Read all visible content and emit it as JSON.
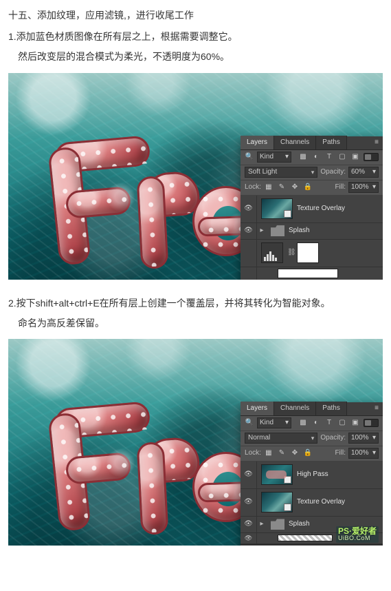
{
  "watermark": {
    "brand": "PS·爱好者",
    "url": "UiBO.CoM"
  },
  "sectionTitle": "十五、添加纹理，应用滤镜,，进行收尾工作",
  "step1": {
    "line1": "1.添加蓝色材质图像在所有层之上，根据需要调整它。",
    "line2": "然后改变层的混合模式为柔光，不透明度为60%。"
  },
  "step2": {
    "line1": "2.按下shift+alt+ctrl+E在所有层上创建一个覆盖层，并将其转化为智能对象。",
    "line2": "命名为高反差保留。"
  },
  "panel1": {
    "tabs": {
      "layers": "Layers",
      "channels": "Channels",
      "paths": "Paths"
    },
    "filter": {
      "label": "Kind"
    },
    "blend": {
      "mode": "Soft Light",
      "opacityLabel": "Opacity:",
      "opacityValue": "60%"
    },
    "lock": {
      "label": "Lock:",
      "fillLabel": "Fill:",
      "fillValue": "100%"
    },
    "layers": {
      "textureOverlay": "Texture Overlay",
      "splash": "Splash"
    }
  },
  "panel2": {
    "tabs": {
      "layers": "Layers",
      "channels": "Channels",
      "paths": "Paths"
    },
    "filter": {
      "label": "Kind"
    },
    "blend": {
      "mode": "Normal",
      "opacityLabel": "Opacity:",
      "opacityValue": "100%"
    },
    "lock": {
      "label": "Lock:",
      "fillLabel": "Fill:",
      "fillValue": "100%"
    },
    "layers": {
      "highPass": "High Pass",
      "textureOverlay": "Texture Overlay",
      "splash": "Splash"
    }
  },
  "icons": {
    "eye": "👁",
    "search": "🔍",
    "lockRow": "🔒",
    "link": "⛓",
    "fx": "fx",
    "mask": "◧",
    "adjust": "◐",
    "folder": "▣",
    "newLayer": "▦",
    "trash": "🗑",
    "menu": "≡",
    "chevDown": "▾",
    "chevRight": "▸",
    "filterPixel": "▩",
    "filterAdjust": "◐",
    "filterText": "T",
    "filterShape": "▢",
    "filterSmart": "▣",
    "lockTransparent": "▦",
    "lockBrush": "✎",
    "lockMove": "✥",
    "lockAll": "🔒"
  }
}
